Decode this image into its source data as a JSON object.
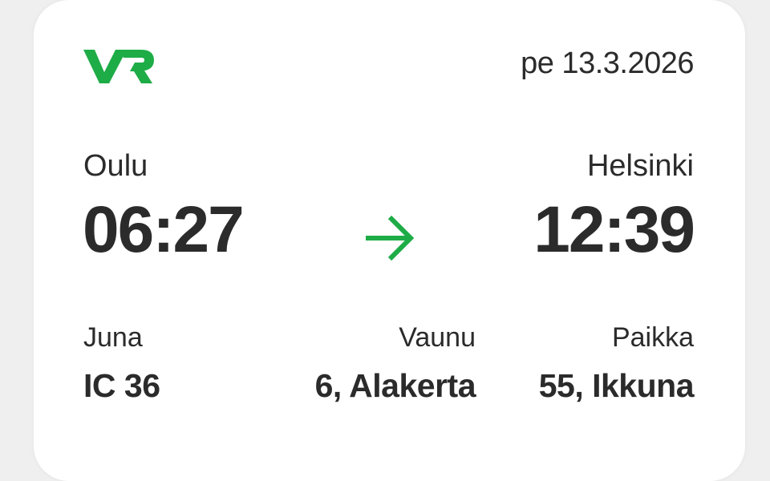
{
  "brand": {
    "logo_text": "VR",
    "accent": "#1eac47"
  },
  "ticket": {
    "date": "pe 13.3.2026",
    "departure": {
      "station": "Oulu",
      "time": "06:27"
    },
    "arrival": {
      "station": "Helsinki",
      "time": "12:39"
    },
    "details": [
      {
        "label": "Juna",
        "value": "IC 36"
      },
      {
        "label": "Vaunu",
        "value": "6, Alakerta"
      },
      {
        "label": "Paikka",
        "value": "55, Ikkuna"
      }
    ]
  },
  "icons": {
    "direction": "arrow-right-icon"
  }
}
